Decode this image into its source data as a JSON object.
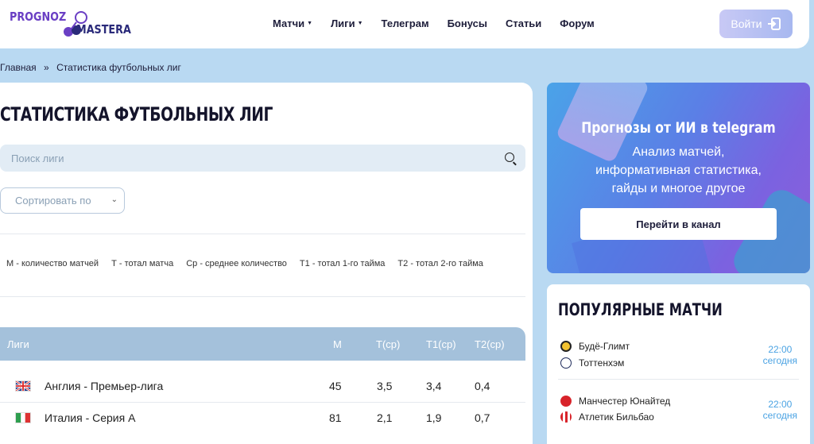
{
  "header": {
    "logo_top": "PROGNOZ",
    "logo_bottom": "MASTERA",
    "nav": [
      {
        "label": "Матчи",
        "dropdown": true
      },
      {
        "label": "Лиги",
        "dropdown": true
      },
      {
        "label": "Телеграм",
        "dropdown": false
      },
      {
        "label": "Бонусы",
        "dropdown": false
      },
      {
        "label": "Статьи",
        "dropdown": false
      },
      {
        "label": "Форум",
        "dropdown": false
      }
    ],
    "login_label": "Войти"
  },
  "breadcrumb": {
    "home": "Главная",
    "sep": "»",
    "current": "Статистика футбольных лиг"
  },
  "main": {
    "title": "СТАТИСТИКА ФУТБОЛЬНЫХ ЛИГ",
    "search_placeholder": "Поиск лиги",
    "sort_label": "Сортировать по",
    "legend": [
      "М - количество матчей",
      "Т - тотал матча",
      "Ср - среднее количество",
      "Т1 - тотал 1-го тайма",
      "Т2 - тотал 2-го тайма"
    ],
    "table": {
      "headers": {
        "league": "Лиги",
        "m": "М",
        "t": "Т(ср)",
        "t1": "Т1(ср)",
        "t2": "Т2(ср)"
      },
      "rows": [
        {
          "flag": "england",
          "name": "Англия - Премьер-лига",
          "m": "45",
          "t": "3,5",
          "t1": "3,4",
          "t2": "0,4"
        },
        {
          "flag": "italy",
          "name": "Италия - Серия А",
          "m": "81",
          "t": "2,1",
          "t1": "1,9",
          "t2": "0,7"
        }
      ]
    }
  },
  "promo": {
    "title": "Прогнозы от ИИ в telegram",
    "line1": "Анализ матчей,",
    "line2": "информативная статистика,",
    "line3": "гайды и многое другое",
    "button": "Перейти в канал"
  },
  "popular": {
    "title": "ПОПУЛЯРНЫЕ МАТЧИ",
    "matches": [
      {
        "home": "Будё-Глимт",
        "away": "Тоттенхэм",
        "time": "22:00",
        "day": "сегодня"
      },
      {
        "home": "Манчестер Юнайтед",
        "away": "Атлетик Бильбао",
        "time": "22:00",
        "day": "сегодня"
      }
    ]
  },
  "colors": {
    "accent": "#4ba3e3",
    "brand": "#6a3fc4",
    "table_head": "#a4c1db",
    "bg": "#b9d9f2"
  }
}
